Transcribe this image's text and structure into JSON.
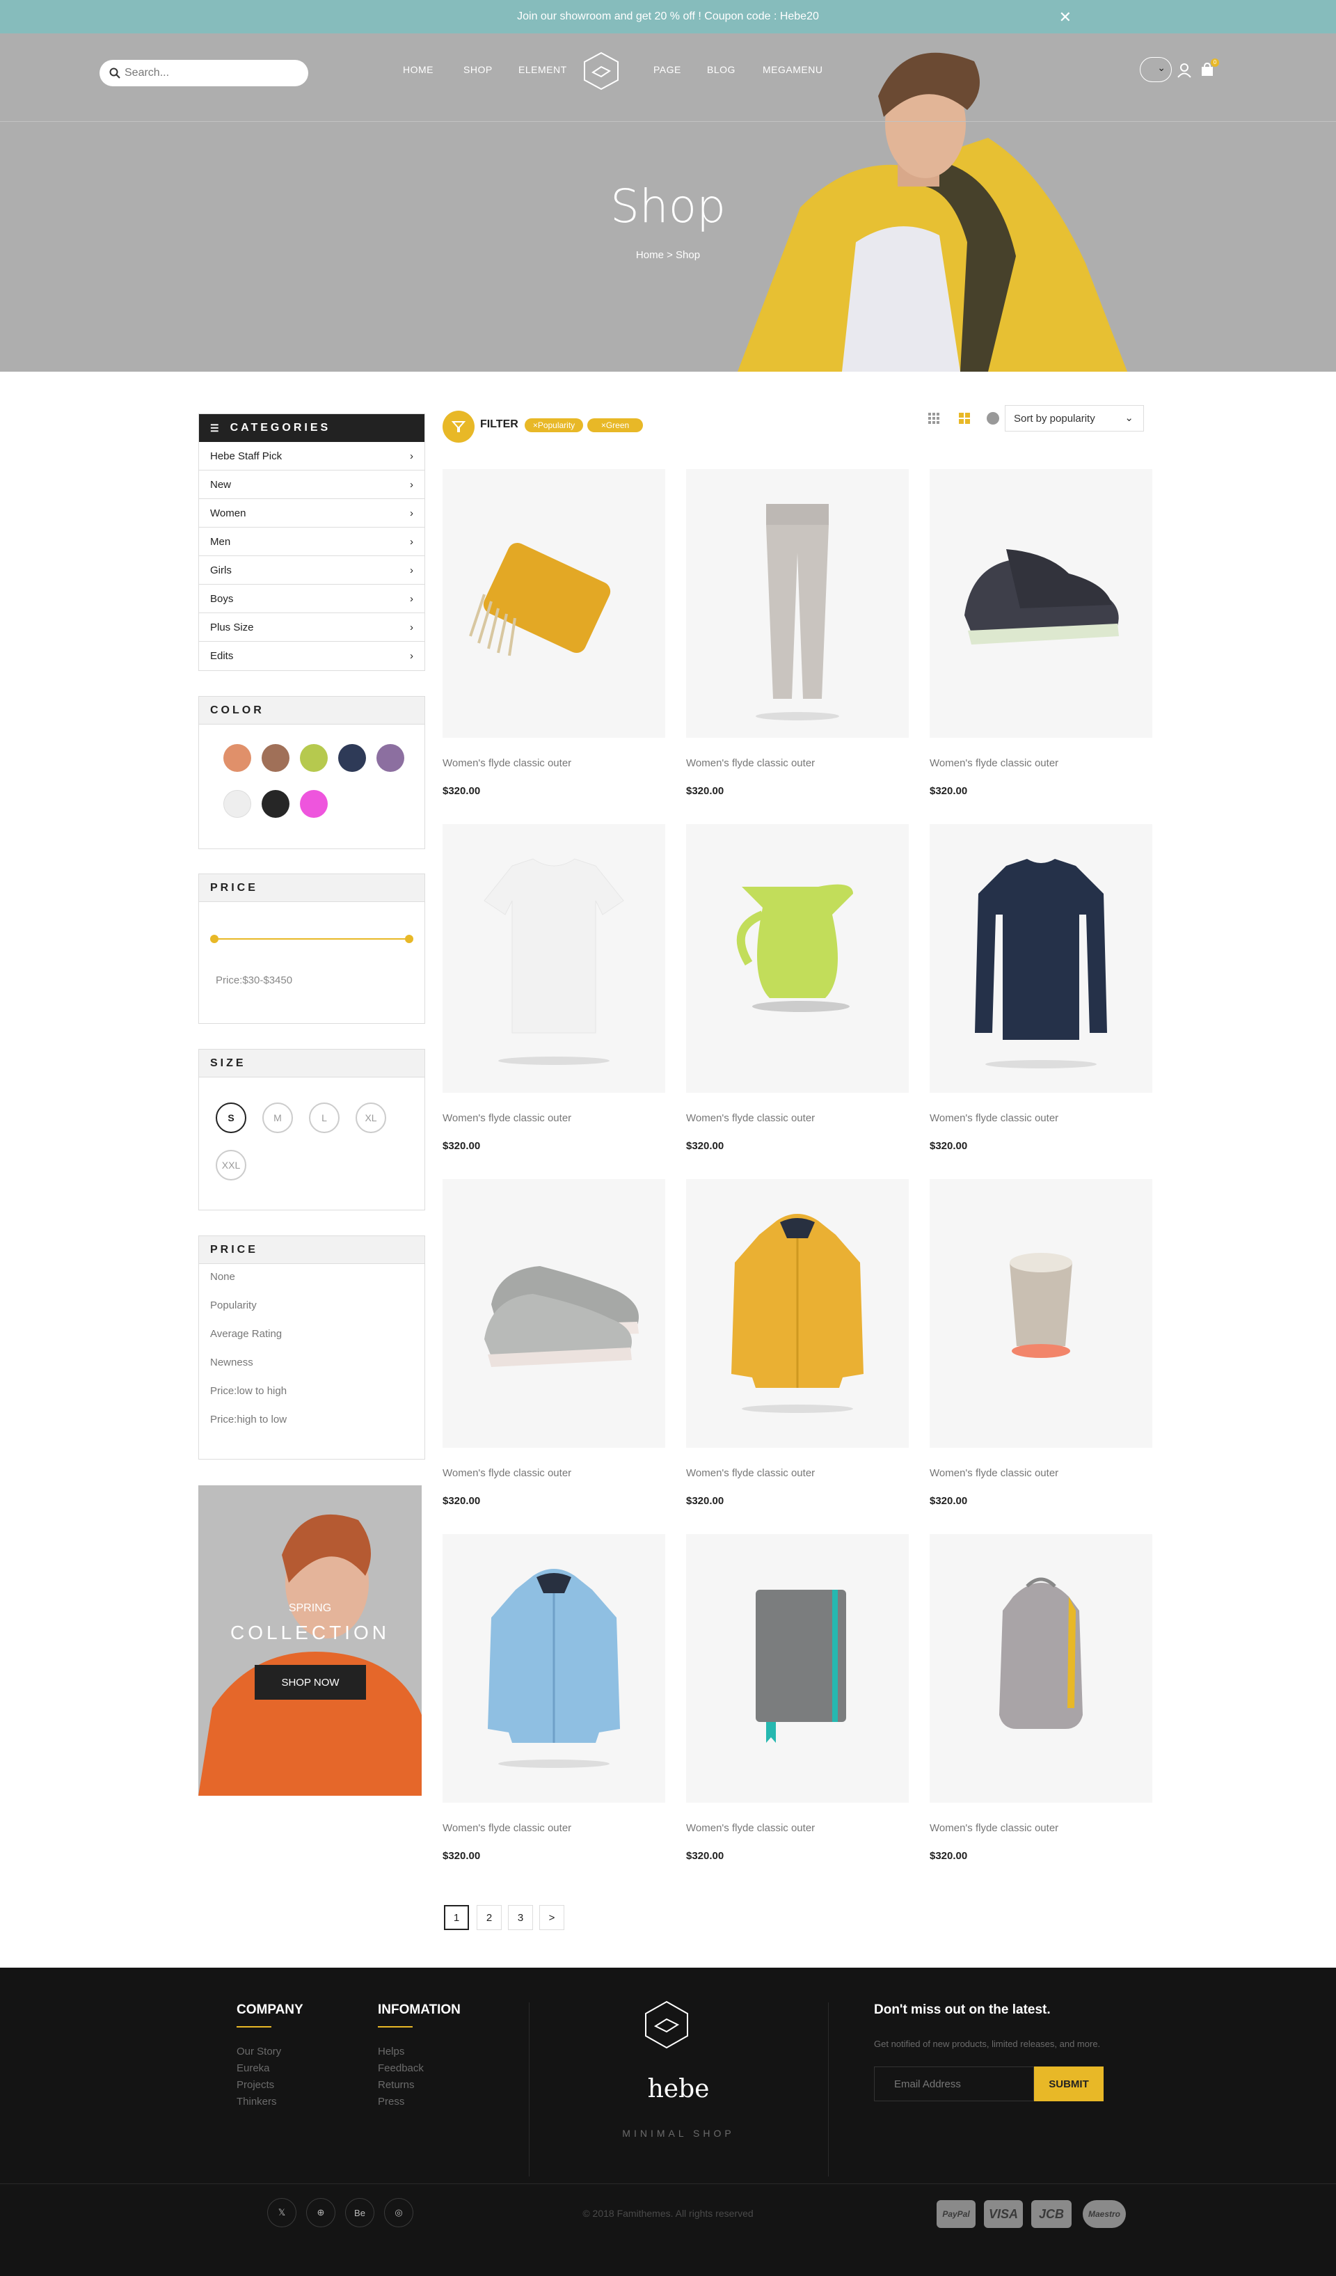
{
  "topbar": {
    "message": "Join our showroom and get 20 % off ! Coupon code : Hebe20",
    "close": "✕"
  },
  "header": {
    "search_placeholder": "Search...",
    "nav": [
      "HOME",
      "SHOP",
      "ELEMENT",
      "PAGE",
      "BLOG",
      "MEGAMENU"
    ],
    "cart_count": "0"
  },
  "hero": {
    "title": "Shop",
    "breadcrumb": "Home > Shop"
  },
  "sidebar": {
    "categories_title": "CATEGORIES",
    "categories": [
      "Hebe Staff Pick",
      "New",
      "Women",
      "Men",
      "Girls",
      "Boys",
      "Plus Size",
      "Edits"
    ],
    "color_title": "COLOR",
    "colors": [
      "#e0906a",
      "#a07058",
      "#b6c94e",
      "#2e3a57",
      "#8c6fa0",
      "#eeeeee",
      "#262626",
      "#ee55dd"
    ],
    "price_title": "PRICE",
    "price_range_text": "Price:$30-$3450",
    "size_title": "SIZE",
    "sizes": [
      "S",
      "M",
      "L",
      "XL",
      "XXL"
    ],
    "sort_title": "PRICE",
    "sort_options": [
      "None",
      "Popularity",
      "Average Rating",
      "Newness",
      "Price:low to high",
      "Price:high to low"
    ],
    "promo": {
      "kicker": "SPRING",
      "title": "COLLECTION",
      "button": "SHOP NOW"
    }
  },
  "toolbar": {
    "filter_label": "FILTER",
    "tags": [
      "×Popularity",
      "×Green"
    ],
    "sort_selected": "Sort by popularity"
  },
  "products": [
    {
      "name": "Women's flyde classic outer",
      "price": "$320.00",
      "icon": "blanket"
    },
    {
      "name": "Women's flyde classic outer",
      "price": "$320.00",
      "icon": "pants"
    },
    {
      "name": "Women's flyde classic outer",
      "price": "$320.00",
      "icon": "dark-sneaker"
    },
    {
      "name": "Women's flyde classic outer",
      "price": "$320.00",
      "icon": "white-tshirt"
    },
    {
      "name": "Women's flyde classic outer",
      "price": "$320.00",
      "icon": "pitcher"
    },
    {
      "name": "Women's flyde classic outer",
      "price": "$320.00",
      "icon": "navy-sweater"
    },
    {
      "name": "Women's flyde classic outer",
      "price": "$320.00",
      "icon": "grey-sneakers"
    },
    {
      "name": "Women's flyde classic outer",
      "price": "$320.00",
      "icon": "yellow-jacket"
    },
    {
      "name": "Women's flyde classic outer",
      "price": "$320.00",
      "icon": "candle"
    },
    {
      "name": "Women's flyde classic outer",
      "price": "$320.00",
      "icon": "blue-jacket"
    },
    {
      "name": "Women's flyde classic outer",
      "price": "$320.00",
      "icon": "notebook"
    },
    {
      "name": "Women's flyde classic outer",
      "price": "$320.00",
      "icon": "backpack"
    }
  ],
  "pagination": [
    "1",
    "2",
    "3",
    ">"
  ],
  "footer": {
    "company_title": "COMPANY",
    "company_links": [
      "Our Story",
      "Eureka",
      "Projects",
      "Thinkers"
    ],
    "info_title": "INFOMATION",
    "info_links": [
      "Helps",
      "Feedback",
      "Returns",
      "Press"
    ],
    "brand": "hebe",
    "tagline": "MINIMAL SHOP",
    "newsletter_title": "Don't miss out on the latest.",
    "newsletter_text": "Get notified of new products, limited releases, and more.",
    "email_placeholder": "Email Address",
    "submit": "SUBMIT",
    "copyright": "© 2018 Famithemes. All rights reserved",
    "social": [
      "𝕏",
      "⊕",
      "Be",
      "◎"
    ],
    "payments": [
      "PayPal",
      "VISA",
      "JCB",
      "Maestro"
    ]
  }
}
